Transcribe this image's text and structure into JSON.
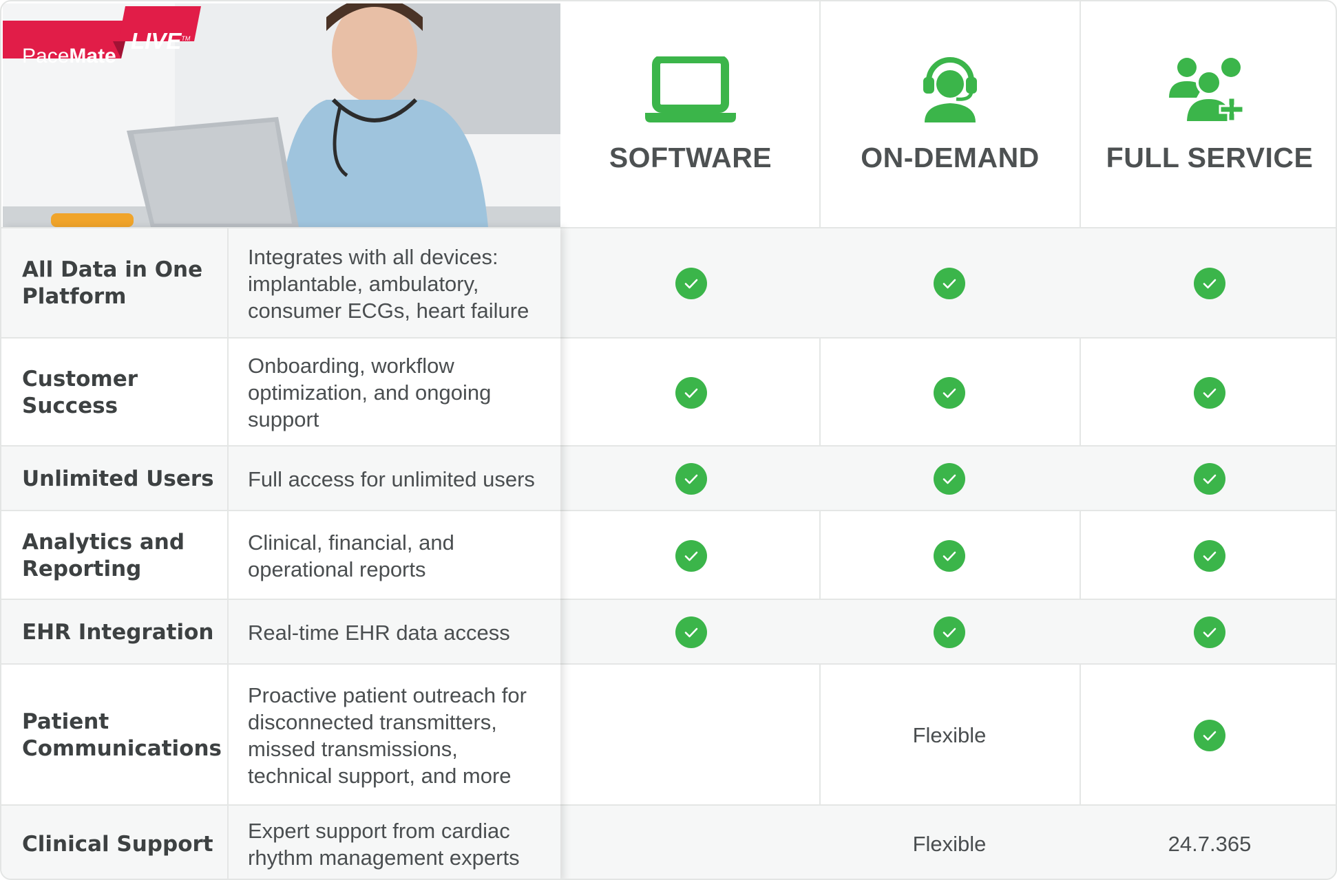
{
  "brand": {
    "name_part1": "Pace",
    "name_part2": "Mate",
    "live": "LIVE",
    "tm": "TM",
    "red": "#e11d48"
  },
  "plans": [
    {
      "name": "SOFTWARE",
      "icon": "laptop-icon"
    },
    {
      "name": "ON-DEMAND",
      "icon": "headset-icon"
    },
    {
      "name": "FULL SERVICE",
      "icon": "add-users-icon"
    }
  ],
  "check_color": "#3bb54a",
  "rows": [
    {
      "feature": [
        "All Data in One",
        "Platform"
      ],
      "description": [
        "Integrates with all devices:",
        "implantable, ambulatory,",
        "consumer ECGs, heart failure"
      ],
      "software": "check",
      "on_demand": "check",
      "full_service": "check"
    },
    {
      "feature": [
        "Customer",
        "Success"
      ],
      "description": [
        "Onboarding, workflow",
        "optimization, and ongoing",
        "support"
      ],
      "software": "check",
      "on_demand": "check",
      "full_service": "check"
    },
    {
      "feature": [
        "Unlimited Users"
      ],
      "description": [
        "Full access for unlimited users"
      ],
      "software": "check",
      "on_demand": "check",
      "full_service": "check"
    },
    {
      "feature": [
        "Analytics and",
        "Reporting"
      ],
      "description": [
        "Clinical, financial, and",
        "operational reports"
      ],
      "software": "check",
      "on_demand": "check",
      "full_service": "check"
    },
    {
      "feature": [
        "EHR Integration"
      ],
      "description": [
        "Real-time EHR data access"
      ],
      "software": "check",
      "on_demand": "check",
      "full_service": "check"
    },
    {
      "feature": [
        "Patient",
        "Communications"
      ],
      "description": [
        "Proactive patient outreach for",
        "disconnected transmitters,",
        "missed transmissions,",
        "technical support, and more"
      ],
      "software": "",
      "on_demand": "Flexible",
      "full_service": "check"
    },
    {
      "feature": [
        "Clinical Support"
      ],
      "description": [
        "Expert support from cardiac",
        "rhythm management experts"
      ],
      "software": "",
      "on_demand": "Flexible",
      "full_service": "24.7.365"
    }
  ]
}
